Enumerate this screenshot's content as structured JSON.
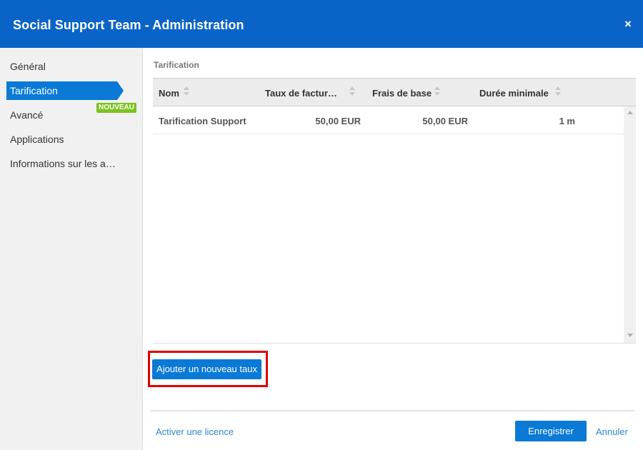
{
  "window": {
    "title": "Social Support Team - Administration",
    "close_icon": "×"
  },
  "sidebar": {
    "items": [
      {
        "label": "Général",
        "active": false
      },
      {
        "label": "Tarification",
        "active": true
      },
      {
        "label": "Avancé",
        "active": false
      },
      {
        "label": "Applications",
        "active": false
      },
      {
        "label": "Informations sur les applications",
        "active": false,
        "badge": "NOUVEAU"
      }
    ]
  },
  "main": {
    "section_title": "Tarification",
    "table": {
      "columns": [
        "Nom",
        "Taux de facturation",
        "Frais de base",
        "Durée minimale"
      ],
      "rows": [
        [
          "Tarification Support",
          "50,00 EUR",
          "50,00 EUR",
          "1 m"
        ]
      ]
    },
    "add_button": "Ajouter un nouveau taux"
  },
  "footer": {
    "license_link": "Activer une licence",
    "save_button": "Enregistrer",
    "cancel_link": "Annuler"
  },
  "colors": {
    "header_bg": "#0a64c8",
    "accent": "#0a7ad6",
    "badge": "#7cc21f",
    "highlight": "#e00000",
    "link": "#2a87d0"
  }
}
